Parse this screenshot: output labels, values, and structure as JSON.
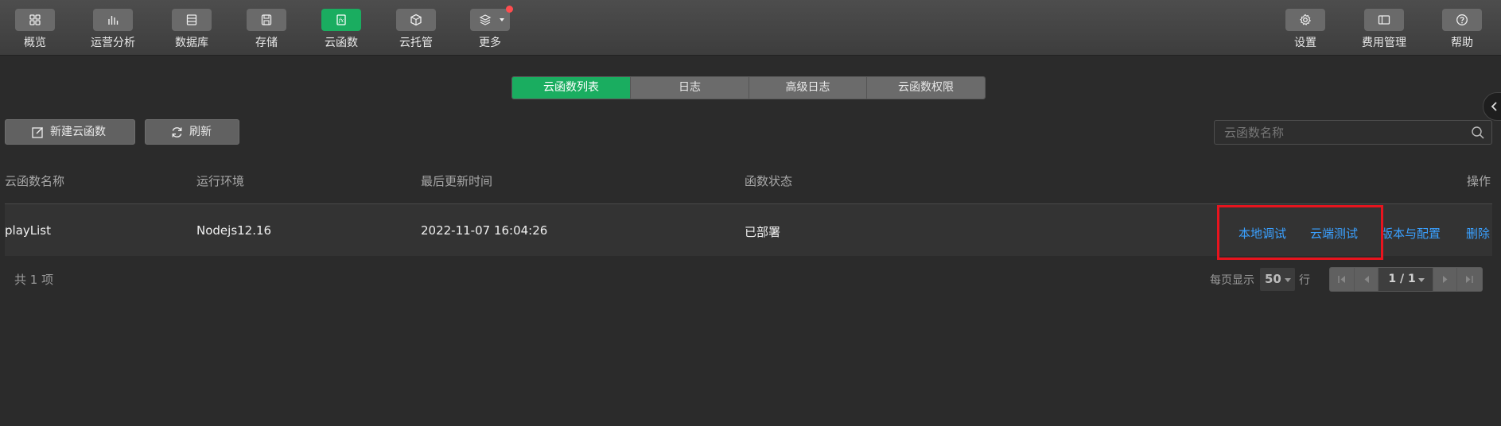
{
  "toolbar": {
    "left": [
      {
        "label": "概览",
        "icon": "grid-icon"
      },
      {
        "label": "运营分析",
        "icon": "bar-chart-icon"
      },
      {
        "label": "数据库",
        "icon": "database-icon"
      },
      {
        "label": "存储",
        "icon": "storage-icon"
      },
      {
        "label": "云函数",
        "icon": "cloud-function-icon",
        "active": true
      },
      {
        "label": "云托管",
        "icon": "cube-icon"
      },
      {
        "label": "更多",
        "icon": "layers-icon",
        "badge": true
      }
    ],
    "right": [
      {
        "label": "设置",
        "icon": "gear-icon"
      },
      {
        "label": "费用管理",
        "icon": "billing-icon"
      },
      {
        "label": "帮助",
        "icon": "help-icon"
      }
    ]
  },
  "tabs": [
    {
      "label": "云函数列表",
      "active": true
    },
    {
      "label": "日志"
    },
    {
      "label": "高级日志"
    },
    {
      "label": "云函数权限"
    }
  ],
  "actions": {
    "new_label": "新建云函数",
    "refresh_label": "刷新"
  },
  "search": {
    "placeholder": "云函数名称"
  },
  "table": {
    "columns": [
      "云函数名称",
      "运行环境",
      "最后更新时间",
      "函数状态",
      "操作"
    ],
    "rows": [
      {
        "name": "playList",
        "runtime": "Nodejs12.16",
        "updated": "2022-11-07 16:04:26",
        "status": "已部署",
        "ops": [
          "本地调试",
          "云端测试",
          "版本与配置",
          "删除"
        ]
      }
    ]
  },
  "footer": {
    "total": "共 1 项",
    "per_page_prefix": "每页显示",
    "per_page_value": "50",
    "per_page_suffix": "行",
    "page_indicator": "1 / 1"
  },
  "colors": {
    "accent": "#1aad60",
    "link": "#3aa0ff",
    "highlight_border": "#e8141e",
    "badge": "#ff4d4f"
  }
}
